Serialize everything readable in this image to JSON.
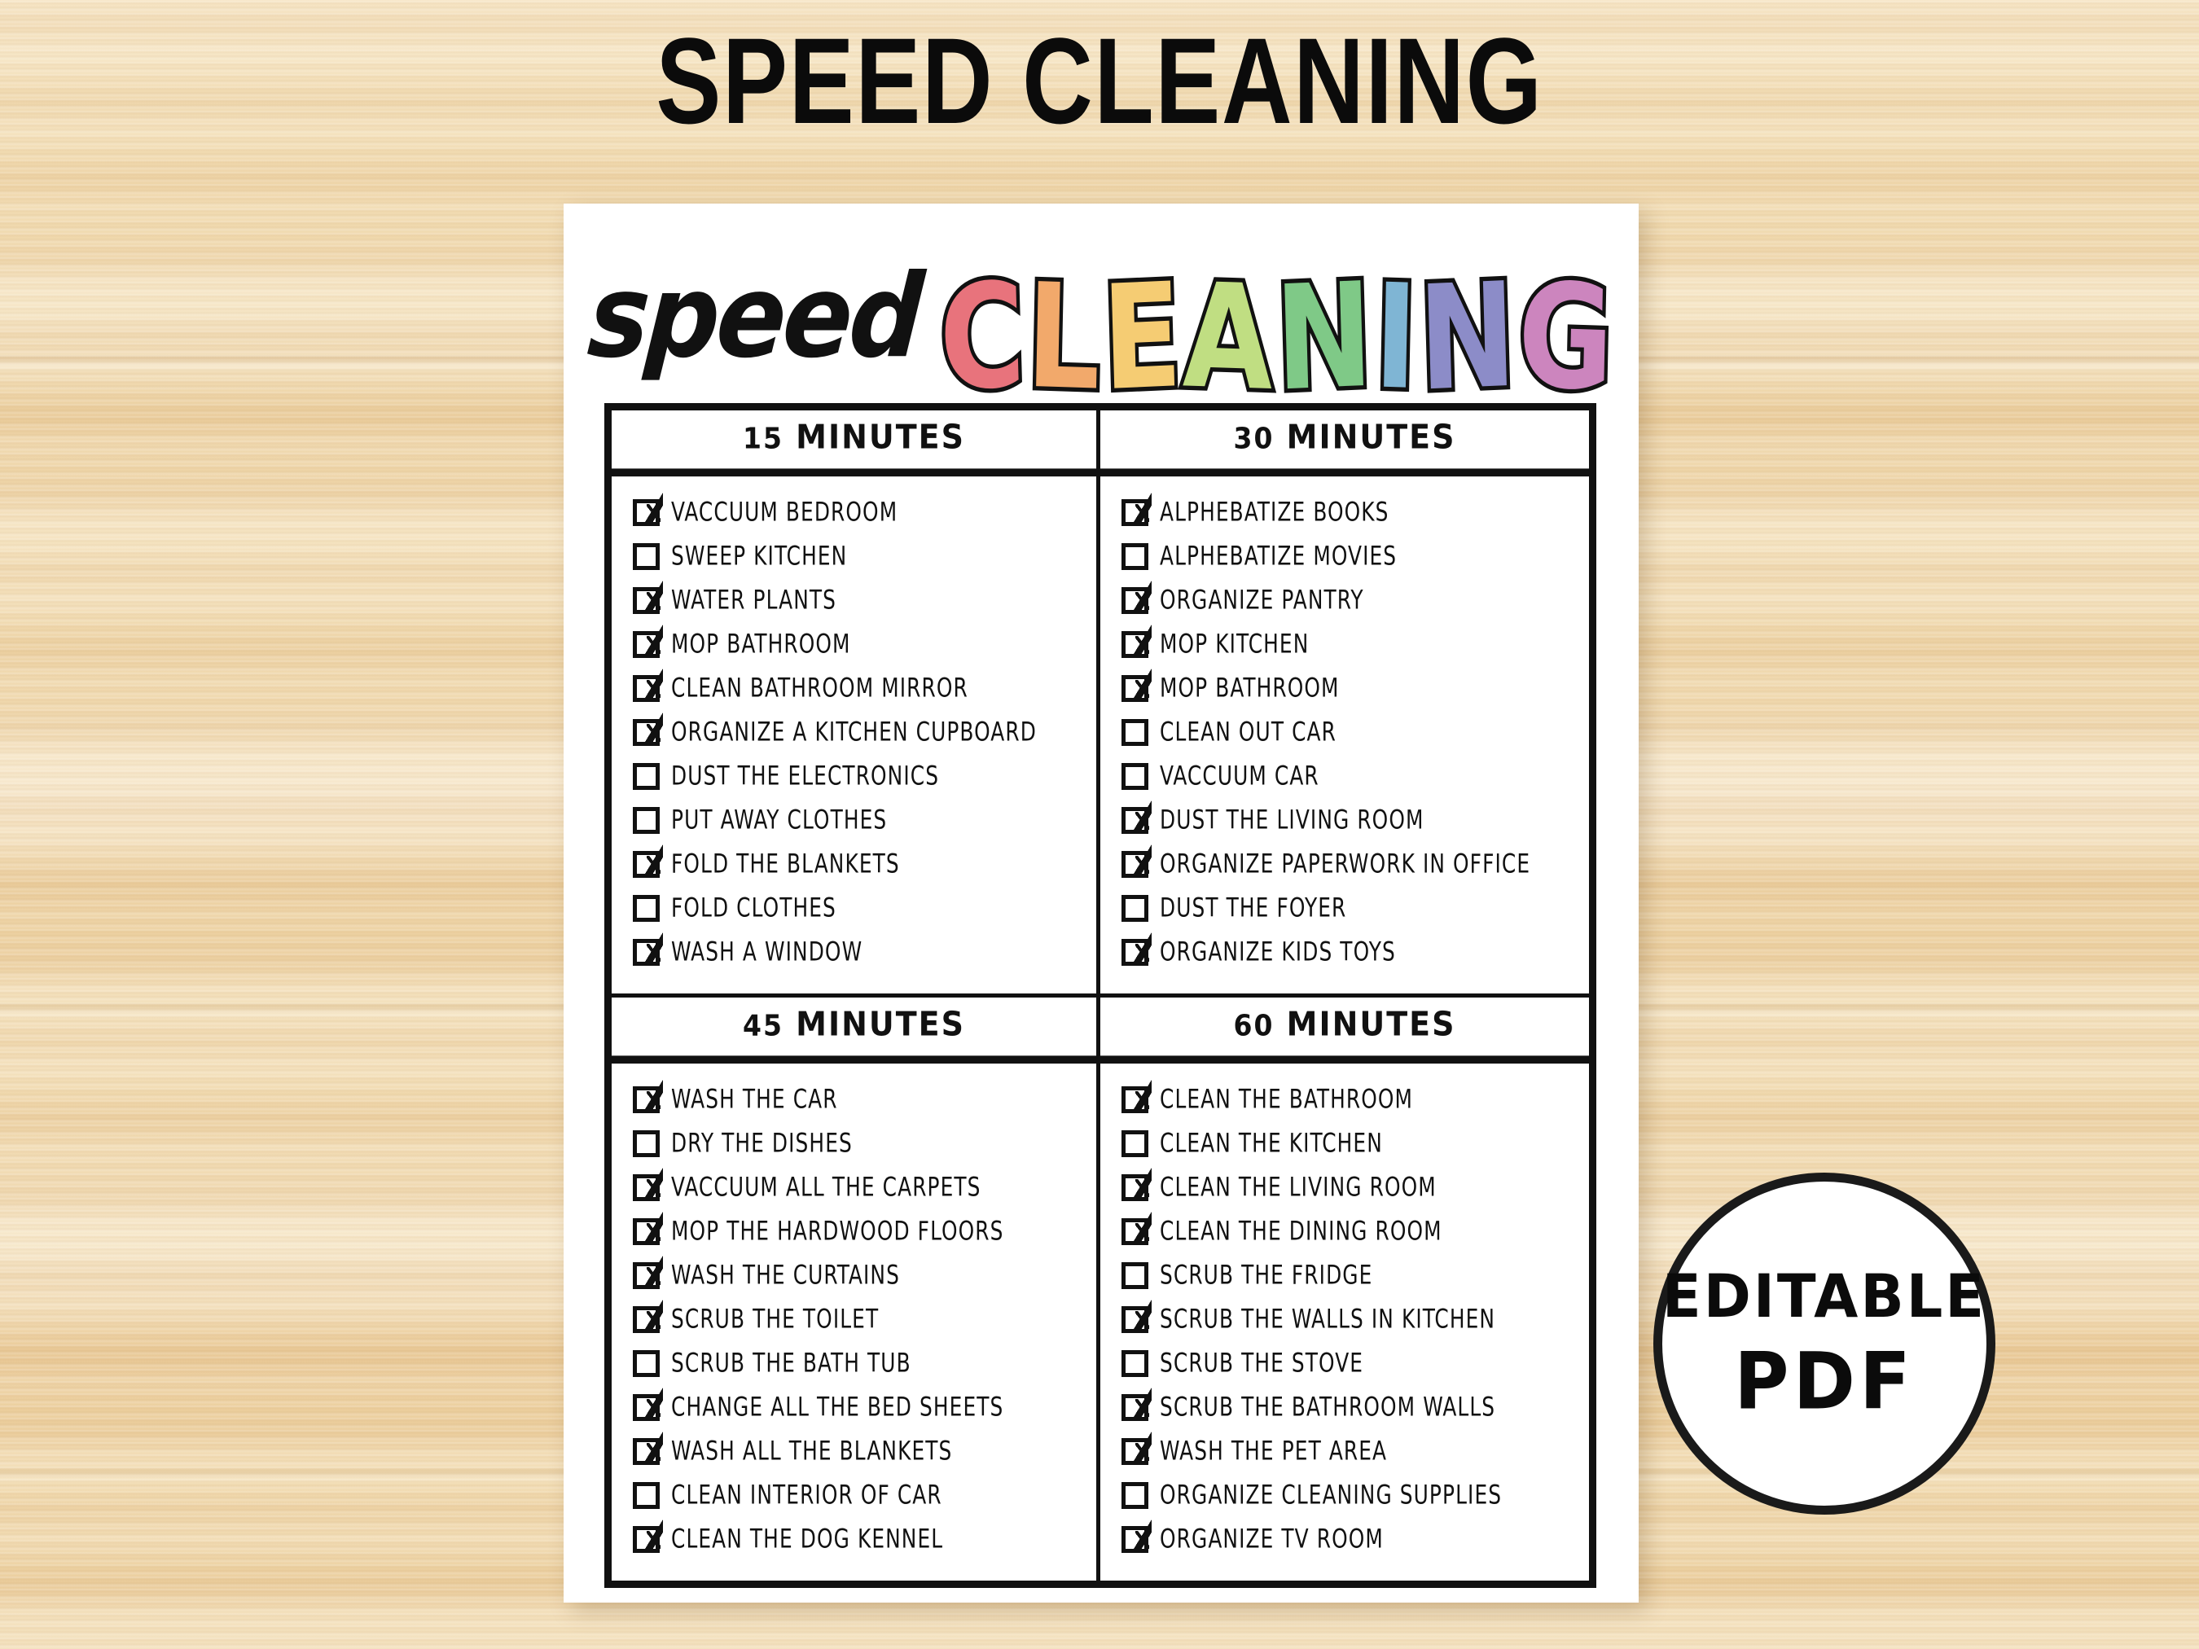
{
  "banner": {
    "title": "SPEED CLEANING"
  },
  "logo": {
    "script_word": "speed",
    "letters": [
      {
        "char": "C",
        "color": "#E8737C"
      },
      {
        "char": "L",
        "color": "#F2A96B"
      },
      {
        "char": "E",
        "color": "#F5CC73"
      },
      {
        "char": "A",
        "color": "#C0DE82"
      },
      {
        "char": "N",
        "color": "#7FC987"
      },
      {
        "char": "I",
        "color": "#7FB5D4"
      },
      {
        "char": "N",
        "color": "#8C8CC8"
      },
      {
        "char": "G",
        "color": "#CC85BE"
      }
    ]
  },
  "badge": {
    "line1": "EDITABLE",
    "line2": "PDF"
  },
  "quadrants": [
    {
      "header_num": "15",
      "header_unit": "MINUTES",
      "tasks": [
        {
          "label": "VACCUUM BEDROOM",
          "checked": true
        },
        {
          "label": "SWEEP KITCHEN",
          "checked": false
        },
        {
          "label": "WATER PLANTS",
          "checked": true
        },
        {
          "label": "MOP BATHROOM",
          "checked": true
        },
        {
          "label": "CLEAN BATHROOM MIRROR",
          "checked": true
        },
        {
          "label": "ORGANIZE A KITCHEN CUPBOARD",
          "checked": true
        },
        {
          "label": "DUST THE ELECTRONICS",
          "checked": false
        },
        {
          "label": "PUT AWAY CLOTHES",
          "checked": false
        },
        {
          "label": "FOLD THE BLANKETS",
          "checked": true
        },
        {
          "label": "FOLD CLOTHES",
          "checked": false
        },
        {
          "label": "WASH A WINDOW",
          "checked": true
        }
      ]
    },
    {
      "header_num": "30",
      "header_unit": "MINUTES",
      "tasks": [
        {
          "label": "ALPHEBATIZE BOOKS",
          "checked": true
        },
        {
          "label": "ALPHEBATIZE MOVIES",
          "checked": false
        },
        {
          "label": "ORGANIZE PANTRY",
          "checked": true
        },
        {
          "label": "MOP KITCHEN",
          "checked": true
        },
        {
          "label": "MOP BATHROOM",
          "checked": true
        },
        {
          "label": "CLEAN OUT CAR",
          "checked": false
        },
        {
          "label": "VACCUUM CAR",
          "checked": false
        },
        {
          "label": "DUST THE LIVING ROOM",
          "checked": true
        },
        {
          "label": "ORGANIZE PAPERWORK IN OFFICE",
          "checked": true
        },
        {
          "label": "DUST THE FOYER",
          "checked": false
        },
        {
          "label": "ORGANIZE KIDS TOYS",
          "checked": true
        }
      ]
    },
    {
      "header_num": "45",
      "header_unit": "MINUTES",
      "tasks": [
        {
          "label": "WASH THE CAR",
          "checked": true
        },
        {
          "label": "DRY THE DISHES",
          "checked": false
        },
        {
          "label": "VACCUUM ALL THE CARPETS",
          "checked": true
        },
        {
          "label": "MOP THE HARDWOOD FLOORS",
          "checked": true
        },
        {
          "label": "WASH THE CURTAINS",
          "checked": true
        },
        {
          "label": "SCRUB THE TOILET",
          "checked": true
        },
        {
          "label": "SCRUB THE BATH TUB",
          "checked": false
        },
        {
          "label": "CHANGE ALL THE BED SHEETS",
          "checked": true
        },
        {
          "label": "WASH ALL THE BLANKETS",
          "checked": true
        },
        {
          "label": "CLEAN INTERIOR OF CAR",
          "checked": false
        },
        {
          "label": "CLEAN THE DOG KENNEL",
          "checked": true
        }
      ]
    },
    {
      "header_num": "60",
      "header_unit": "MINUTES",
      "tasks": [
        {
          "label": "CLEAN THE BATHROOM",
          "checked": true
        },
        {
          "label": "CLEAN THE KITCHEN",
          "checked": false
        },
        {
          "label": "CLEAN THE LIVING ROOM",
          "checked": true
        },
        {
          "label": "CLEAN THE DINING ROOM",
          "checked": true
        },
        {
          "label": "SCRUB THE FRIDGE",
          "checked": false
        },
        {
          "label": "SCRUB THE WALLS IN KITCHEN",
          "checked": true
        },
        {
          "label": "SCRUB THE STOVE",
          "checked": false
        },
        {
          "label": "SCRUB THE BATHROOM WALLS",
          "checked": true
        },
        {
          "label": "WASH THE PET AREA",
          "checked": true
        },
        {
          "label": "ORGANIZE CLEANING SUPPLIES",
          "checked": false
        },
        {
          "label": "ORGANIZE TV ROOM",
          "checked": true
        }
      ]
    }
  ],
  "colors": {
    "ink": "#111111",
    "paper": "#FFFFFF",
    "wood_light": "#F7E7C8",
    "wood_dark": "#E9C893"
  }
}
